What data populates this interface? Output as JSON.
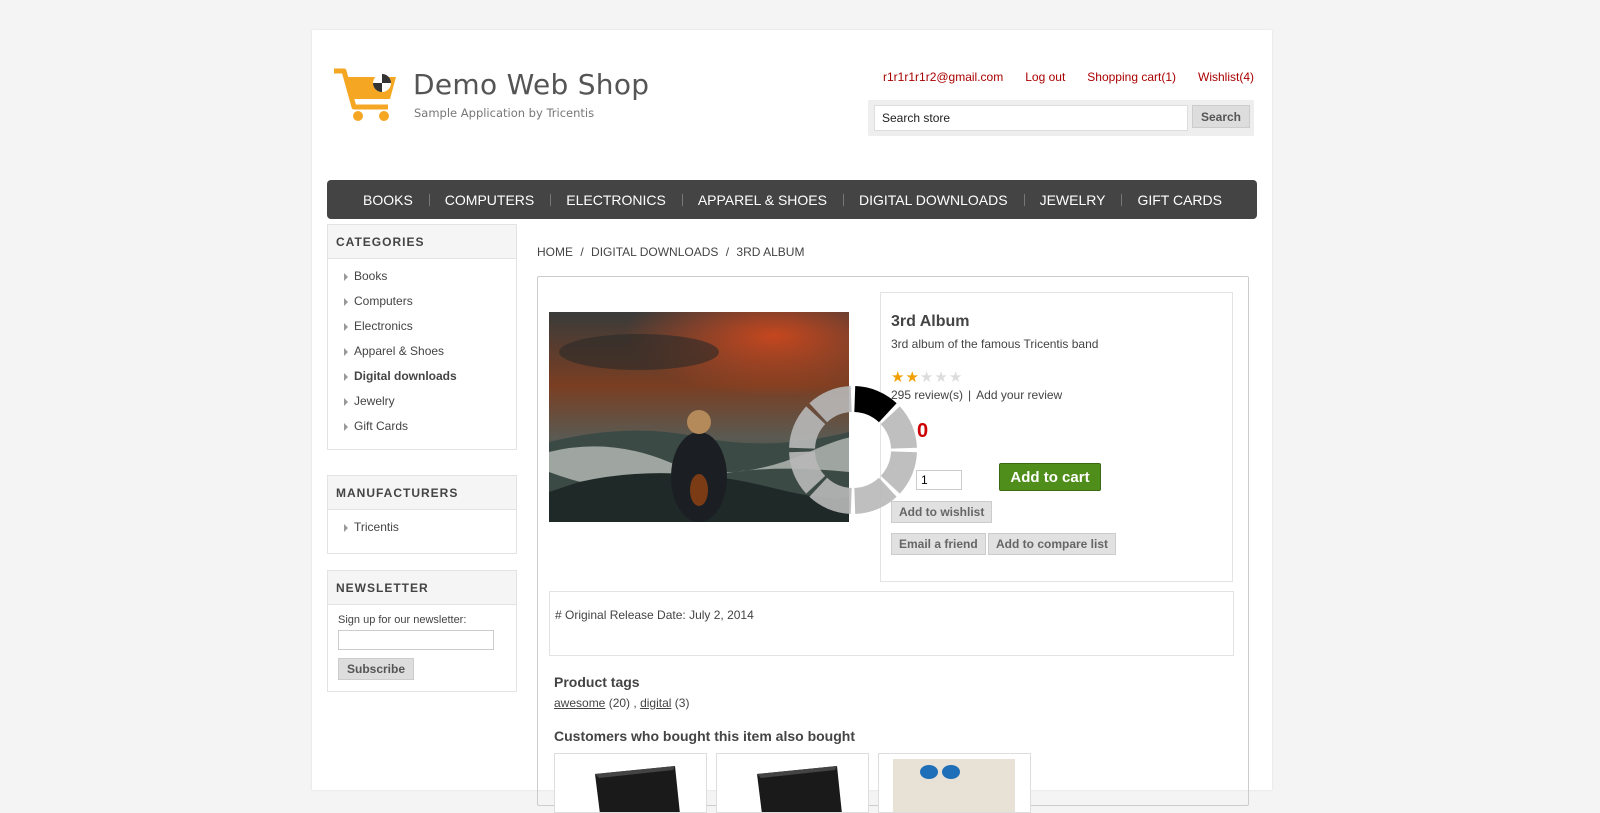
{
  "header": {
    "logo_title": "Demo Web Shop",
    "logo_subtitle": "Sample Application by Tricentis",
    "links": {
      "account": "r1r1r1r1r2@gmail.com",
      "logout": "Log out",
      "cart": "Shopping cart(1)",
      "wishlist": "Wishlist(4)"
    },
    "search": {
      "value": "Search store",
      "button": "Search"
    }
  },
  "menu": [
    "BOOKS",
    "COMPUTERS",
    "ELECTRONICS",
    "APPAREL & SHOES",
    "DIGITAL DOWNLOADS",
    "JEWELRY",
    "GIFT CARDS"
  ],
  "sidebar": {
    "categories_title": "CATEGORIES",
    "categories": [
      "Books",
      "Computers",
      "Electronics",
      "Apparel & Shoes",
      "Digital downloads",
      "Jewelry",
      "Gift Cards"
    ],
    "active_category": "Digital downloads",
    "manufacturers_title": "MANUFACTURERS",
    "manufacturers": [
      "Tricentis"
    ],
    "newsletter_title": "NEWSLETTER",
    "newsletter_label": "Sign up for our newsletter:",
    "subscribe_label": "Subscribe"
  },
  "breadcrumb": {
    "home": "HOME",
    "sep": "/",
    "category": "DIGITAL DOWNLOADS",
    "current": "3RD ALBUM"
  },
  "product": {
    "name": "3rd Album",
    "short_description": "3rd album of the famous Tricentis band",
    "rating": 2,
    "rating_max": 5,
    "reviews": "295 review(s)",
    "review_sep": "|",
    "add_review": "Add your review",
    "price": "0",
    "quantity": "1",
    "add_to_cart": "Add to cart",
    "add_to_wishlist": "Add to wishlist",
    "email_friend": "Email a friend",
    "add_to_compare": "Add to compare list",
    "full_description": "# Original Release Date: July 2, 2014",
    "tags_title": "Product tags",
    "tags": [
      {
        "name": "awesome",
        "count": "(20)"
      },
      {
        "name": "digital",
        "count": "(3)"
      }
    ],
    "tag_sep": ",",
    "also_bought_title": "Customers who bought this item also bought"
  },
  "colors": {
    "link": "#aa0000",
    "menu_bg": "#444444",
    "add_to_cart": "#4f8e1a",
    "price": "#cc0000",
    "star": "#f0a000"
  }
}
